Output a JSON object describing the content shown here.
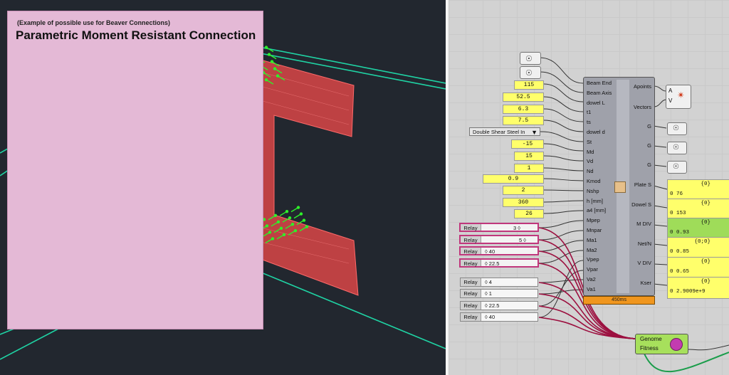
{
  "viewport": {
    "background": "#22272f",
    "edge_color": "#1fd3a4",
    "surface_color": "#e04a4a",
    "arrow_color": "#2ef02a"
  },
  "group": {
    "caption": "(Example of possible use for Beaver Connections)",
    "title": "Parametric Moment Resistant Connection",
    "color": "#e4b9d6"
  },
  "panels": [
    "115",
    "52.5",
    "6.3",
    "7.5",
    "-15",
    "15",
    "1",
    "0.9",
    "2",
    "360",
    "26"
  ],
  "value_list": {
    "selected": "Double Shear Steel In"
  },
  "sliders_selected": [
    {
      "label": "Relay",
      "value": "3 ◊"
    },
    {
      "label": "Relay",
      "value": "5 ◊"
    },
    {
      "label": "Relay",
      "value": "◊ 40"
    },
    {
      "label": "Relay",
      "value": "◊ 22.5"
    }
  ],
  "sliders": [
    {
      "label": "Relay",
      "value": "◊ 4"
    },
    {
      "label": "Relay",
      "value": "◊ 1"
    },
    {
      "label": "Relay",
      "value": "◊ 22.5"
    },
    {
      "label": "Relay",
      "value": "◊ 40"
    }
  ],
  "component": {
    "inputs": [
      "Beam End",
      "Beam Axis",
      "dowel L",
      "t1",
      "ts",
      "dowel d",
      "St",
      "Md",
      "Vd",
      "Nd",
      "Kmod",
      "Nshp",
      "h [mm]",
      "a4 [mm]",
      "Mpep",
      "Mnpar",
      "Ma1",
      "Ma2",
      "Vpep",
      "Vpar",
      "Va2",
      "Va1"
    ],
    "outputs": [
      "Apoints",
      "Vectors",
      "G",
      "G",
      "G",
      "Plate S",
      "Dowel S",
      "M DIV",
      "Net/N",
      "V DIV",
      "Kser"
    ],
    "timer": "450ms"
  },
  "av_param": {
    "a": "A",
    "v": "V"
  },
  "output_panels": [
    {
      "header": "{0}",
      "value": "0 76",
      "green": false
    },
    {
      "header": "{0}",
      "value": "0 153",
      "green": false
    },
    {
      "header": "{0}",
      "value": "0 0.93",
      "green": true
    },
    {
      "header": "{0;0}",
      "value": "0 0.85",
      "green": false
    },
    {
      "header": "{0}",
      "value": "0 0.65",
      "green": false
    },
    {
      "header": "{0}",
      "value": "0 2.9009e+9",
      "green": false
    }
  ],
  "genome": {
    "line1": "Genome",
    "line2": "Fitness"
  },
  "wire_color": "#9c0f3f"
}
